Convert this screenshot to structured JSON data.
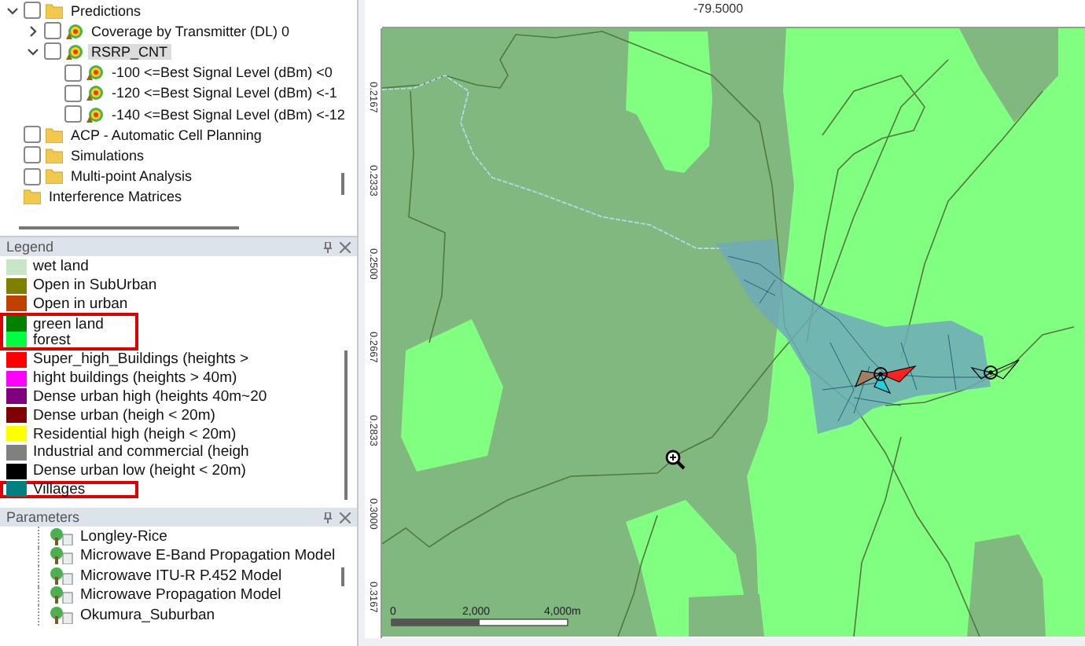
{
  "explorer": {
    "items": [
      {
        "label": "Predictions",
        "kind": "folder",
        "checked": false,
        "expanded": true,
        "selected": false,
        "children": [
          {
            "label": "Coverage by Transmitter (DL) 0",
            "kind": "prediction",
            "checked": false,
            "expanded": false,
            "selected": false
          },
          {
            "label": "RSRP_CNT",
            "kind": "prediction",
            "checked": false,
            "expanded": true,
            "selected": true,
            "children": [
              {
                "label": "-100 <=Best Signal Level (dBm) <0",
                "kind": "prediction",
                "checked": false,
                "selected": false
              },
              {
                "label": "-120 <=Best Signal Level (dBm) <-1",
                "kind": "prediction",
                "checked": false,
                "selected": false
              },
              {
                "label": "-140 <=Best Signal Level (dBm) <-12",
                "kind": "prediction",
                "checked": false,
                "selected": false
              }
            ]
          }
        ]
      },
      {
        "label": "ACP - Automatic Cell Planning",
        "kind": "folder",
        "checked": false,
        "selected": false
      },
      {
        "label": "Simulations",
        "kind": "folder",
        "checked": false,
        "selected": false
      },
      {
        "label": "Multi-point Analysis",
        "kind": "folder",
        "checked": false,
        "selected": false
      },
      {
        "label": "Interference Matrices",
        "kind": "folder",
        "selected": false
      }
    ]
  },
  "legend": {
    "title": "Legend",
    "items": [
      {
        "label": "wet land",
        "color": "#c8e6c8",
        "highlighted": false
      },
      {
        "label": "Open in SubUrban",
        "color": "#808000",
        "highlighted": false
      },
      {
        "label": "Open in urban",
        "color": "#c04000",
        "highlighted": false
      },
      {
        "label": "green land",
        "color": "#008000",
        "highlighted": true
      },
      {
        "label": "forest",
        "color": "#00ff40",
        "highlighted": true
      },
      {
        "label": "Super_high_Buildings (heights >",
        "color": "#ff0000",
        "highlighted": false
      },
      {
        "label": "hight buildings (heights > 40m)",
        "color": "#ff00ff",
        "highlighted": false
      },
      {
        "label": "Dense urban high (heights 40m~20",
        "color": "#800080",
        "highlighted": false
      },
      {
        "label": "Dense urban  (heigh < 20m)",
        "color": "#800000",
        "highlighted": false
      },
      {
        "label": "Residential high (heigh < 20m)",
        "color": "#ffff00",
        "highlighted": false
      },
      {
        "label": "Industrial and commercial (heigh",
        "color": "#808080",
        "highlighted": false
      },
      {
        "label": "Dense urban low (height < 20m)",
        "color": "#000000",
        "highlighted": false
      },
      {
        "label": "Villages",
        "color": "#008080",
        "highlighted": true
      }
    ]
  },
  "parameters": {
    "title": "Parameters",
    "items": [
      {
        "label": "Longley-Rice"
      },
      {
        "label": "Microwave E-Band Propagation Model"
      },
      {
        "label": "Microwave ITU-R P.452 Model"
      },
      {
        "label": "Microwave Propagation Model"
      },
      {
        "label": "Okumura_Suburban"
      }
    ]
  },
  "map": {
    "top_ruler_label": "-79.5000",
    "left_ruler_labels": [
      "0.2167",
      "0.2333",
      "0.2500",
      "0.2667",
      "0.2833",
      "0.3000",
      "0.3167"
    ],
    "scale_labels": [
      "0",
      "2,000",
      "4,000m"
    ]
  }
}
